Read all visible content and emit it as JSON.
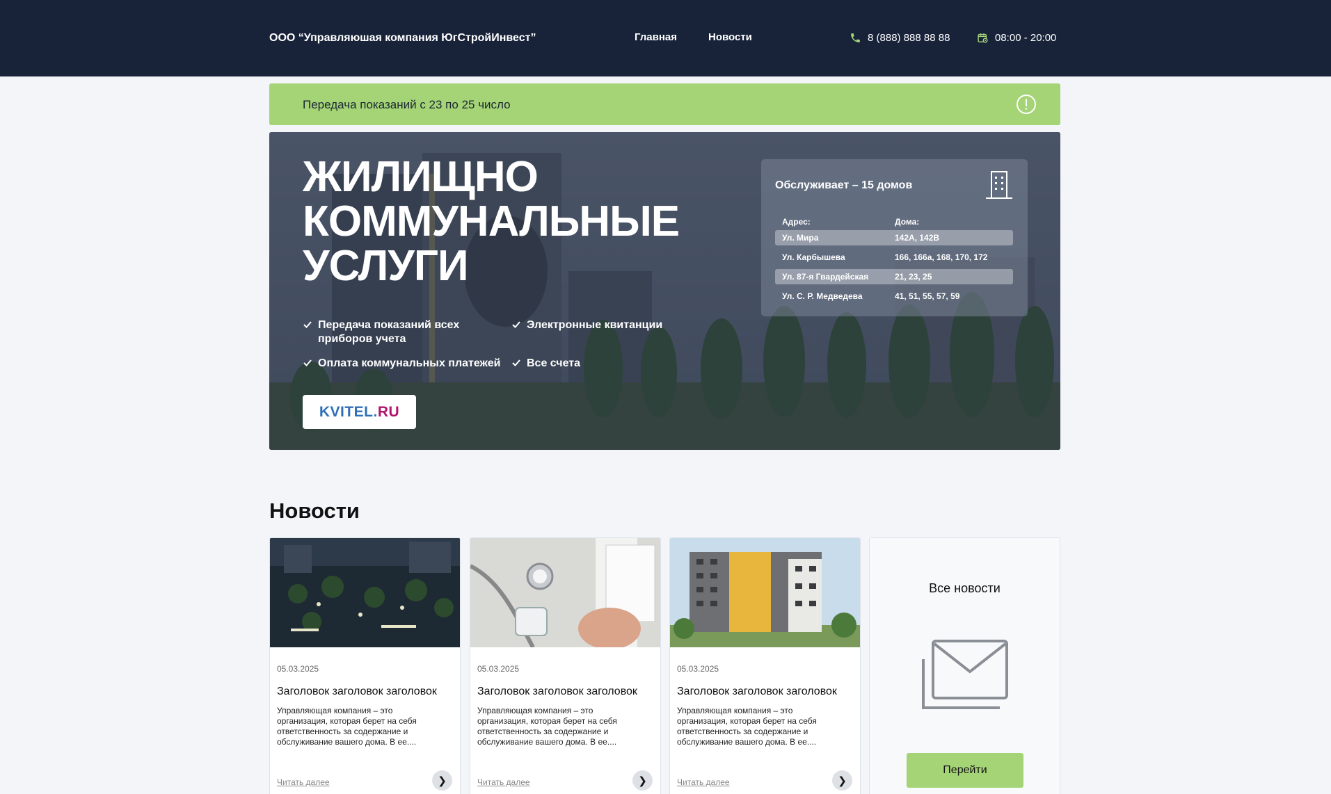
{
  "header": {
    "brand": "ООО “Управляюшая компания ЮгСтройИнвест”",
    "nav": [
      {
        "label": "Главная"
      },
      {
        "label": "Новости"
      }
    ],
    "phone": "8 (888) 888 88 88",
    "hours": "08:00 - 20:00",
    "icons": [
      "phone-icon",
      "calendar-clock-icon"
    ],
    "accent_color": "#a5d477"
  },
  "alert": {
    "text": "Передача показаний с 23 по 25 число",
    "icon": "exclamation-icon"
  },
  "hero": {
    "title_lines": [
      "ЖИЛИЩНО",
      "КОММУНАЛЬНЫЕ",
      "УСЛУГИ"
    ],
    "features": [
      "Передача показаний всех приборов учета",
      "Электронные квитанции",
      "Оплата коммунальных платежей",
      "Все счета"
    ],
    "kvitel": {
      "part1": "KVITEL.",
      "part2": "RU"
    },
    "serve": {
      "title": "Обслуживает – 15 домов",
      "icon": "building-icon",
      "col_address": "Адрес:",
      "col_houses": "Дома:",
      "rows": [
        {
          "address": "Ул. Мира",
          "houses": "142А, 142В"
        },
        {
          "address": "Ул. Карбышева",
          "houses": "166, 166а, 168, 170, 172"
        },
        {
          "address": "Ул. 87-я Гвардейская",
          "houses": "21, 23, 25"
        },
        {
          "address": "Ул. С. Р. Медведева",
          "houses": "41, 51, 55, 57, 59"
        }
      ]
    }
  },
  "news": {
    "heading": "Новости",
    "cards": [
      {
        "date": "05.03.2025",
        "title": "Заголовок заголовок заголовок",
        "text": "Управляющая компания – это организация, которая берет на себя ответственность за содержание и обслуживание вашего дома. В ее....",
        "more": "Читать далее"
      },
      {
        "date": "05.03.2025",
        "title": "Заголовок заголовок заголовок",
        "text": "Управляющая компания – это организация, которая берет на себя ответственность за содержание и обслуживание вашего дома. В ее....",
        "more": "Читать далее"
      },
      {
        "date": "05.03.2025",
        "title": "Заголовок заголовок заголовок",
        "text": "Управляющая компания – это организация, которая берет на себя ответственность за содержание и обслуживание вашего дома. В ее....",
        "more": "Читать далее"
      }
    ],
    "all": {
      "title": "Все новости",
      "button": "Перейти",
      "icon": "envelope-icon"
    }
  }
}
